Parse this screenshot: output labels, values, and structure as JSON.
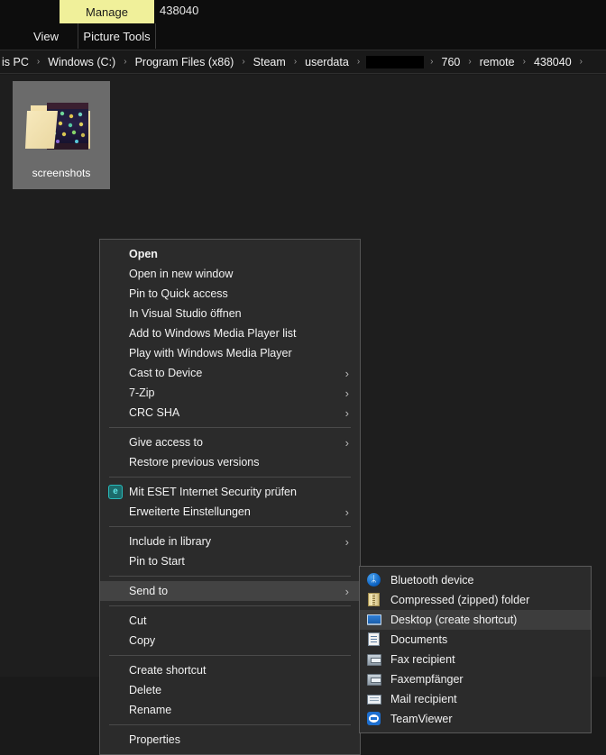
{
  "ribbon": {
    "manage_tab": "Manage",
    "context_title": "438040",
    "view_tab": "View",
    "picture_tools_tab": "Picture Tools",
    "accent_color": "#f0f09a"
  },
  "address_bar": {
    "crumbs": [
      {
        "label": "is PC",
        "redacted": false
      },
      {
        "label": "Windows (C:)",
        "redacted": false
      },
      {
        "label": "Program Files (x86)",
        "redacted": false
      },
      {
        "label": "Steam",
        "redacted": false
      },
      {
        "label": "userdata",
        "redacted": false
      },
      {
        "label": "",
        "redacted": true
      },
      {
        "label": "760",
        "redacted": false
      },
      {
        "label": "remote",
        "redacted": false
      },
      {
        "label": "438040",
        "redacted": false
      }
    ],
    "separator": "›"
  },
  "files": [
    {
      "name": "screenshots",
      "type": "folder",
      "selected": true
    }
  ],
  "context_menu": {
    "items": [
      {
        "label": "Open",
        "bold": true,
        "submenu": false,
        "icon": null
      },
      {
        "label": "Open in new window",
        "bold": false,
        "submenu": false,
        "icon": null
      },
      {
        "label": "Pin to Quick access",
        "bold": false,
        "submenu": false,
        "icon": null
      },
      {
        "label": "In Visual Studio öffnen",
        "bold": false,
        "submenu": false,
        "icon": null
      },
      {
        "label": "Add to Windows Media Player list",
        "bold": false,
        "submenu": false,
        "icon": null
      },
      {
        "label": "Play with Windows Media Player",
        "bold": false,
        "submenu": false,
        "icon": null
      },
      {
        "label": "Cast to Device",
        "bold": false,
        "submenu": true,
        "icon": null
      },
      {
        "label": "7-Zip",
        "bold": false,
        "submenu": true,
        "icon": null
      },
      {
        "label": "CRC SHA",
        "bold": false,
        "submenu": true,
        "icon": null
      },
      {
        "separator": true
      },
      {
        "label": "Give access to",
        "bold": false,
        "submenu": true,
        "icon": null
      },
      {
        "label": "Restore previous versions",
        "bold": false,
        "submenu": false,
        "icon": null
      },
      {
        "separator": true
      },
      {
        "label": "Mit ESET Internet Security prüfen",
        "bold": false,
        "submenu": false,
        "icon": "eset-icon"
      },
      {
        "label": "Erweiterte Einstellungen",
        "bold": false,
        "submenu": true,
        "icon": null
      },
      {
        "separator": true
      },
      {
        "label": "Include in library",
        "bold": false,
        "submenu": true,
        "icon": null
      },
      {
        "label": "Pin to Start",
        "bold": false,
        "submenu": false,
        "icon": null
      },
      {
        "separator": true
      },
      {
        "label": "Send to",
        "bold": false,
        "submenu": true,
        "icon": null,
        "highlighted": true
      },
      {
        "separator": true
      },
      {
        "label": "Cut",
        "bold": false,
        "submenu": false,
        "icon": null
      },
      {
        "label": "Copy",
        "bold": false,
        "submenu": false,
        "icon": null
      },
      {
        "separator": true
      },
      {
        "label": "Create shortcut",
        "bold": false,
        "submenu": false,
        "icon": null
      },
      {
        "label": "Delete",
        "bold": false,
        "submenu": false,
        "icon": null
      },
      {
        "label": "Rename",
        "bold": false,
        "submenu": false,
        "icon": null
      },
      {
        "separator": true
      },
      {
        "label": "Properties",
        "bold": false,
        "submenu": false,
        "icon": null
      }
    ],
    "submenu_arrow": "›"
  },
  "send_to_submenu": {
    "items": [
      {
        "label": "Bluetooth device",
        "icon": "bluetooth-icon",
        "highlighted": false
      },
      {
        "label": "Compressed (zipped) folder",
        "icon": "zip-folder-icon",
        "highlighted": false
      },
      {
        "label": "Desktop (create shortcut)",
        "icon": "desktop-icon",
        "highlighted": true
      },
      {
        "label": "Documents",
        "icon": "documents-icon",
        "highlighted": false
      },
      {
        "label": "Fax recipient",
        "icon": "fax-icon",
        "highlighted": false
      },
      {
        "label": "Faxempfänger",
        "icon": "fax-icon",
        "highlighted": false
      },
      {
        "label": "Mail recipient",
        "icon": "mail-icon",
        "highlighted": false
      },
      {
        "label": "TeamViewer",
        "icon": "teamviewer-icon",
        "highlighted": false
      }
    ]
  }
}
